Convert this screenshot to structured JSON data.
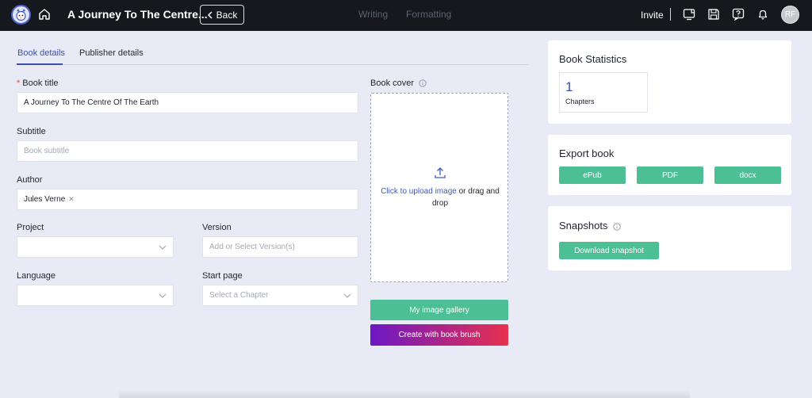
{
  "header": {
    "book_title": "A Journey To The Centre...",
    "back_label": "Back",
    "tabs": [
      "Writing",
      "Formatting"
    ],
    "invite_label": "Invite",
    "avatar_initials": "RF"
  },
  "subtabs": [
    "Book details",
    "Publisher details"
  ],
  "form": {
    "book_title_label": "Book title",
    "book_title_value": "A Journey To The Centre Of The Earth",
    "subtitle_label": "Subtitle",
    "subtitle_placeholder": "Book subtitle",
    "author_label": "Author",
    "author_tag": "Jules Verne",
    "project_label": "Project",
    "version_label": "Version",
    "version_placeholder": "Add or Select Version(s)",
    "language_label": "Language",
    "start_page_label": "Start page",
    "start_page_placeholder": "Select a Chapter"
  },
  "cover": {
    "label": "Book cover",
    "upload_link": "Click to upload image",
    "upload_rest": " or drag and drop",
    "gallery_button": "My image gallery",
    "brush_button": "Create with book brush"
  },
  "stats": {
    "title": "Book Statistics",
    "chapters_count": "1",
    "chapters_label": "Chapters"
  },
  "export": {
    "title": "Export book",
    "buttons": [
      "ePub",
      "PDF",
      "docx"
    ]
  },
  "snapshots": {
    "title": "Snapshots",
    "download_button": "Download snapshot"
  },
  "colors": {
    "accent": "#3d4fa8",
    "green": "#4dbf95",
    "topbar": "#16181d",
    "background": "#e8ebf5"
  }
}
